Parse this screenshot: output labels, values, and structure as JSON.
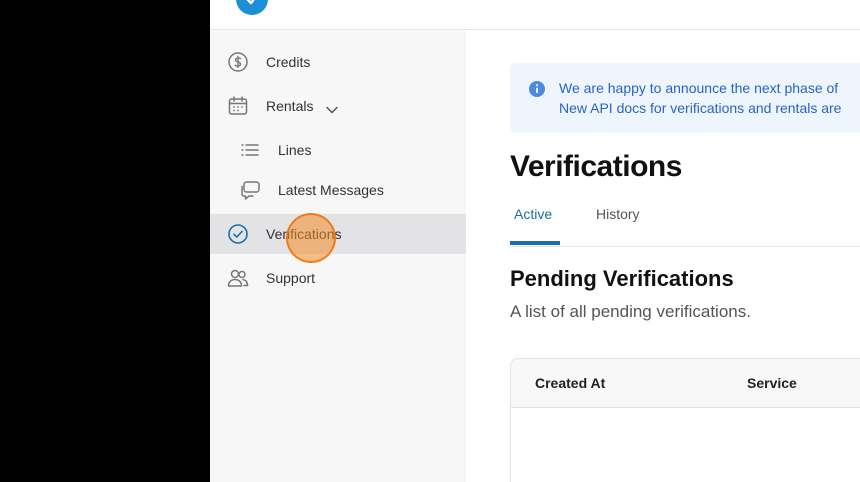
{
  "brand": {
    "logo_left": "",
    "logo_right": ""
  },
  "sidebar": {
    "items": [
      {
        "label": "Credits",
        "icon": "dollar-icon"
      },
      {
        "label": "Rentals",
        "icon": "calendar-icon",
        "expanded": true
      },
      {
        "label": "Lines",
        "icon": "list-icon"
      },
      {
        "label": "Latest Messages",
        "icon": "chat-icon"
      },
      {
        "label": "Verifications",
        "icon": "check-circle-icon",
        "active": true
      },
      {
        "label": "Support",
        "icon": "users-icon"
      }
    ]
  },
  "banner": {
    "line1": "We are happy to announce the next phase of",
    "line2": "New API docs for verifications and rentals are"
  },
  "main": {
    "title": "Verifications",
    "tabs": [
      {
        "label": "Active",
        "active": true
      },
      {
        "label": "History"
      }
    ],
    "section_title": "Pending Verifications",
    "section_subtitle": "A list of all pending verifications.",
    "table": {
      "columns": [
        "Created At",
        "Service"
      ]
    }
  },
  "colors": {
    "accent": "#1a6fa8",
    "brand": "#1c8fd6",
    "banner_bg": "#eef5fd",
    "banner_text": "#2a63c7",
    "cursor": "#f58c28"
  }
}
